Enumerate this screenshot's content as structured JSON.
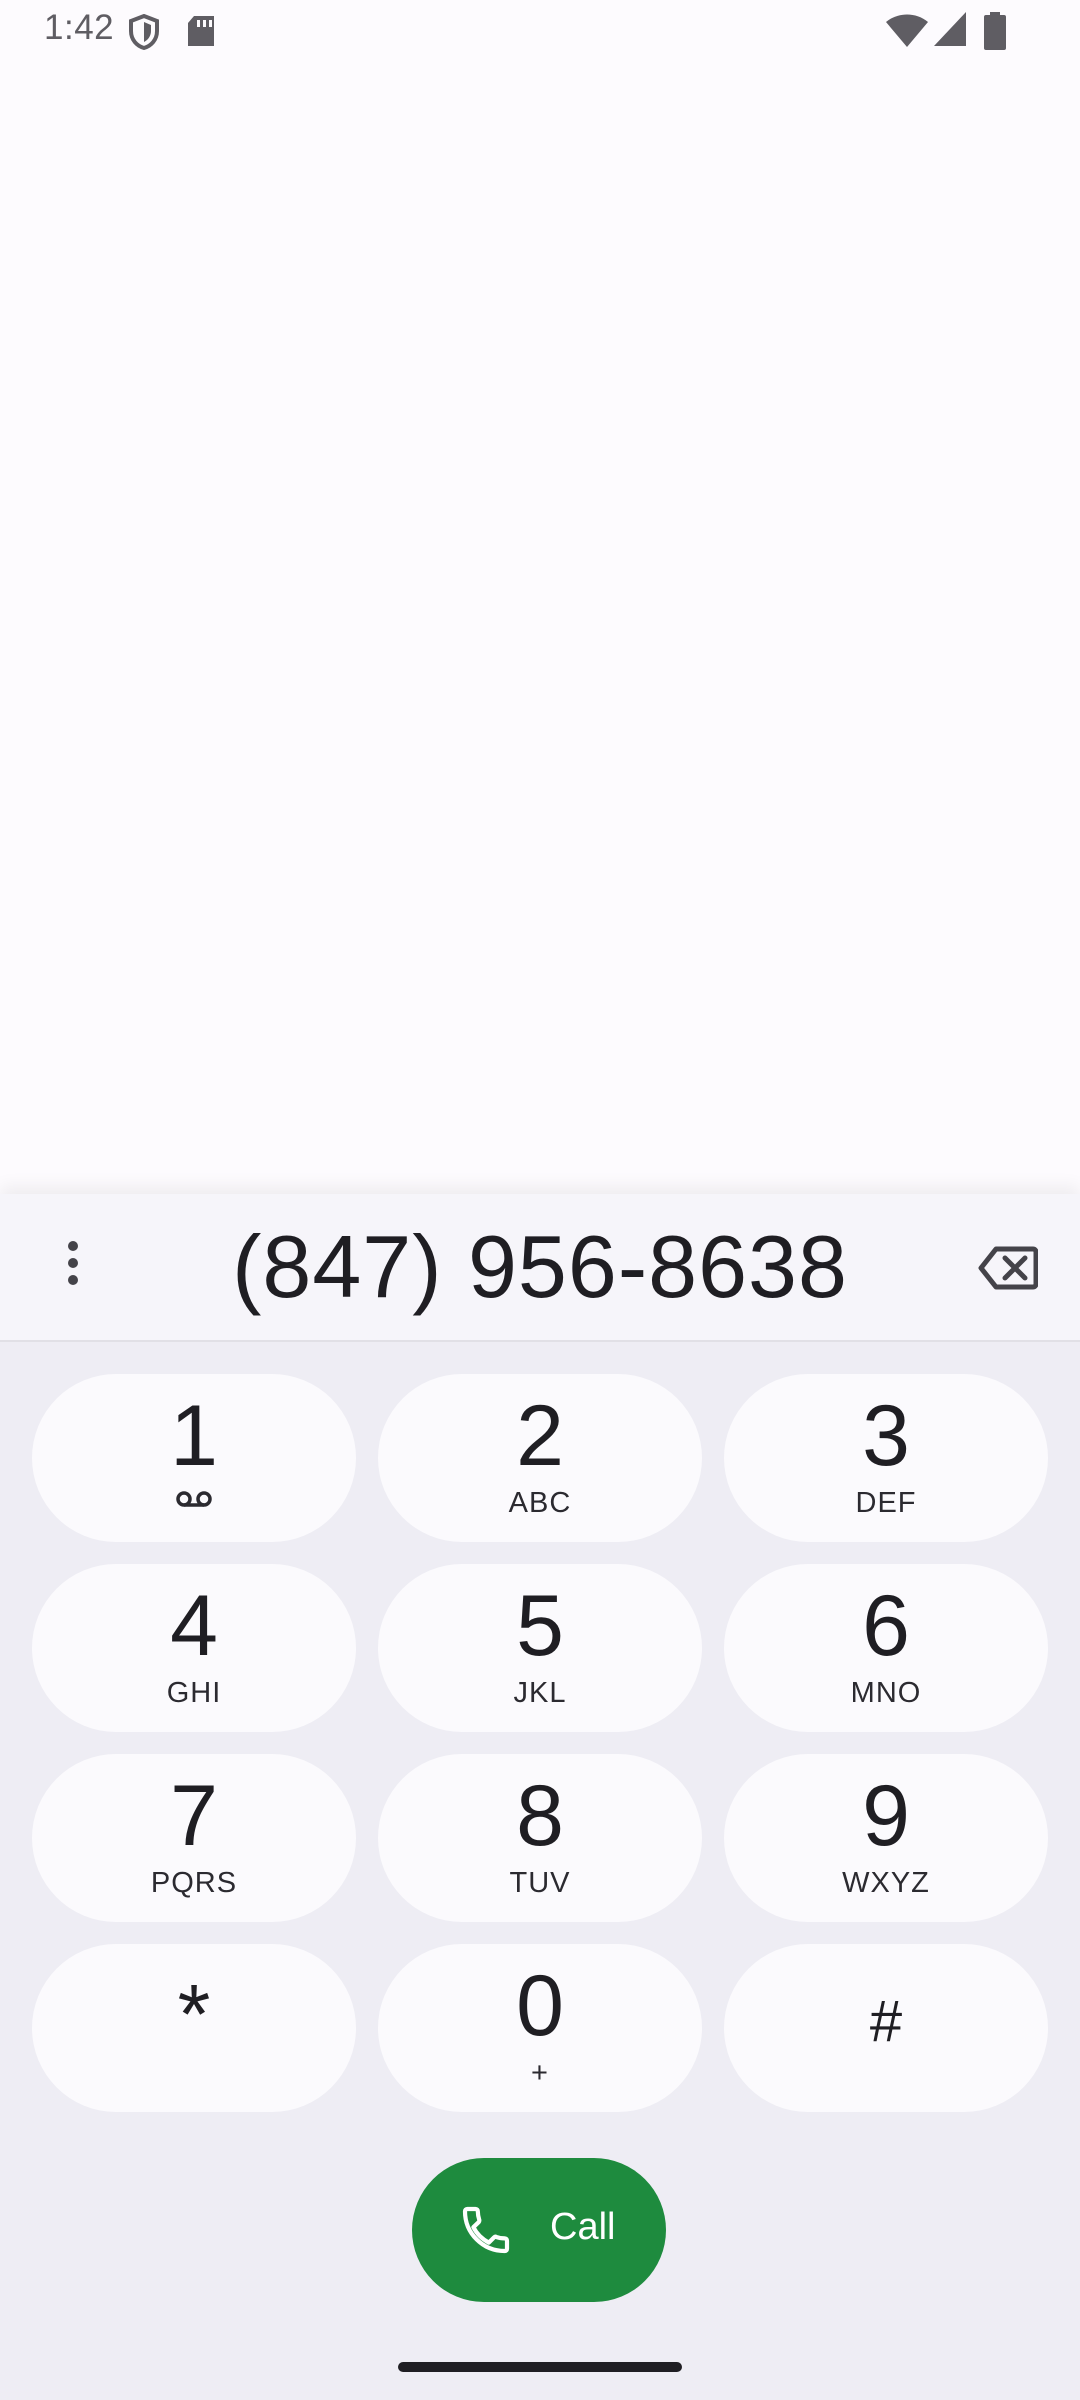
{
  "status_bar": {
    "time": "1:42",
    "icons": [
      "shield-icon",
      "sd-card-icon",
      "wifi-icon",
      "signal-icon",
      "battery-icon"
    ]
  },
  "dialer": {
    "number": "(847) 956-8638",
    "keys": [
      {
        "digit": "1",
        "letters": "",
        "extra_icon": "voicemail-icon"
      },
      {
        "digit": "2",
        "letters": "ABC"
      },
      {
        "digit": "3",
        "letters": "DEF"
      },
      {
        "digit": "4",
        "letters": "GHI"
      },
      {
        "digit": "5",
        "letters": "JKL"
      },
      {
        "digit": "6",
        "letters": "MNO"
      },
      {
        "digit": "7",
        "letters": "PQRS"
      },
      {
        "digit": "8",
        "letters": "TUV"
      },
      {
        "digit": "9",
        "letters": "WXYZ"
      },
      {
        "digit": "*",
        "letters": ""
      },
      {
        "digit": "0",
        "letters": "+"
      },
      {
        "digit": "#",
        "letters": ""
      }
    ],
    "call_label": "Call"
  },
  "colors": {
    "background": "#fdfbfe",
    "dialer_background": "#eeedf4",
    "key_background": "#fbfafd",
    "call_button": "#1e8b3e"
  }
}
